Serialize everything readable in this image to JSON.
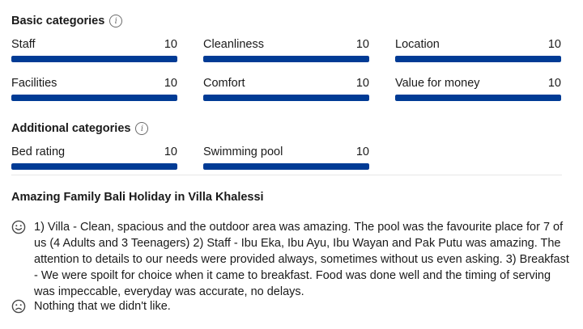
{
  "basic": {
    "title": "Basic categories",
    "items": [
      {
        "label": "Staff",
        "score": "10",
        "fraction": 1.0
      },
      {
        "label": "Cleanliness",
        "score": "10",
        "fraction": 1.0
      },
      {
        "label": "Location",
        "score": "10",
        "fraction": 1.0
      },
      {
        "label": "Facilities",
        "score": "10",
        "fraction": 1.0
      },
      {
        "label": "Comfort",
        "score": "10",
        "fraction": 1.0
      },
      {
        "label": "Value for money",
        "score": "10",
        "fraction": 1.0
      }
    ]
  },
  "additional": {
    "title": "Additional categories",
    "items": [
      {
        "label": "Bed rating",
        "score": "10",
        "fraction": 1.0
      },
      {
        "label": "Swimming pool",
        "score": "10",
        "fraction": 1.0
      }
    ]
  },
  "review": {
    "title": "Amazing Family Bali Holiday in Villa Khalessi",
    "positive": "1) Villa - Clean, spacious and the outdoor area was amazing. The pool was the favourite place for 7 of us (4 Adults and 3 Teenagers) 2) Staff - Ibu Eka, Ibu Ayu, Ibu Wayan and Pak Putu was amazing. The attention to details to our needs were provided always, sometimes without us even asking. 3) Breakfast - We were spoilt for choice when it came to breakfast. Food was done well and the timing of serving was impeccable, everyday was accurate, no delays.",
    "negative": "Nothing that we didn't like."
  },
  "colors": {
    "bar": "#003b95",
    "track": "#e7e7e7"
  },
  "icons": {
    "info": "info-icon",
    "positive": "smiley-face-icon",
    "negative": "frown-face-icon"
  }
}
